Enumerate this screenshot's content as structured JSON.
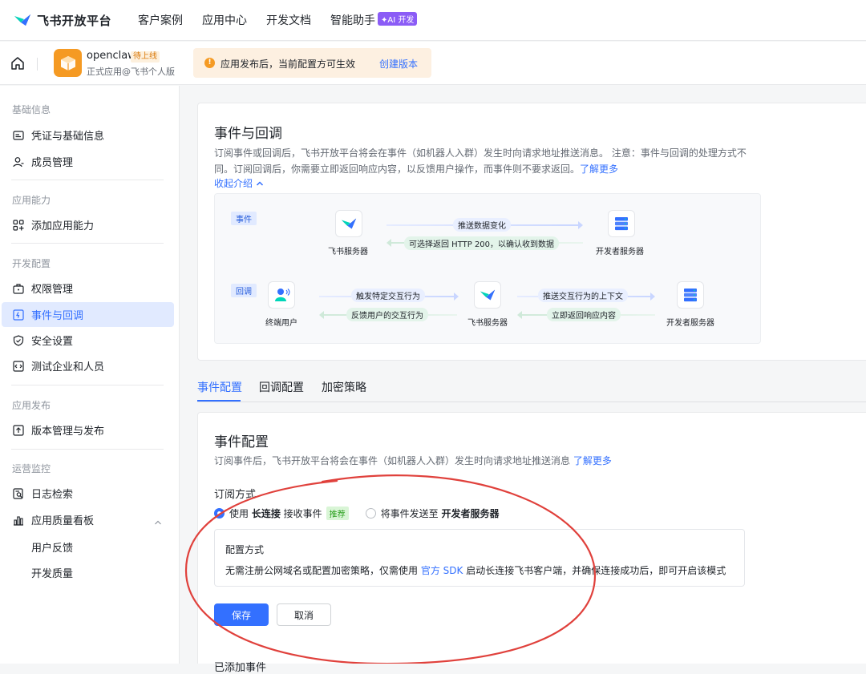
{
  "brand": {
    "name": "飞书开放平台"
  },
  "nav": {
    "items": [
      "客户案例",
      "应用中心",
      "开发文档",
      "智能助手"
    ],
    "ai_badge": "✦AI 开发"
  },
  "app": {
    "name": "openclaw",
    "status": "待上线",
    "owner": "正式应用@飞书个人版"
  },
  "notice": {
    "text": "应用发布后，当前配置方可生效",
    "link": "创建版本",
    "icon": "!"
  },
  "sidebar": {
    "groups": [
      "基础信息",
      "应用能力",
      "开发配置",
      "应用发布",
      "运营监控"
    ],
    "items": {
      "credentials": "凭证与基础信息",
      "members": "成员管理",
      "add_capability": "添加应用能力",
      "permissions": "权限管理",
      "events": "事件与回调",
      "security": "安全设置",
      "test_org": "测试企业和人员",
      "versions": "版本管理与发布",
      "logs": "日志检索",
      "quality_board": "应用质量看板",
      "feedback": "用户反馈",
      "dev_quality": "开发质量"
    }
  },
  "intro": {
    "title": "事件与回调",
    "desc": "订阅事件或回调后，飞书开放平台将会在事件（如机器人入群）发生时向请求地址推送消息。 注意：事件与回调的处理方式不同。订阅回调后，你需要立即返回响应内容，以反馈用户操作，而事件则不要求返回。",
    "learn_more": "了解更多",
    "collapse": "收起介绍"
  },
  "diagram": {
    "event_tag": "事件",
    "callback_tag": "回调",
    "feishu_server": "飞书服务器",
    "dev_server": "开发者服务器",
    "end_user": "终端用户",
    "push_data": "推送数据变化",
    "return_http": "可选择返回 HTTP 200，以确认收到数据",
    "trigger": "触发特定交互行为",
    "feedback": "反馈用户的交互行为",
    "push_context": "推送交互行为的上下文",
    "return_now": "立即返回响应内容"
  },
  "tabs": [
    "事件配置",
    "回调配置",
    "加密策略"
  ],
  "event_config": {
    "title": "事件配置",
    "desc": "订阅事件后，飞书开放平台将会在事件（如机器人入群）发生时向请求地址推送消息",
    "learn_more": "了解更多",
    "subscribe_label": "订阅方式",
    "opt1_pre": "使用 ",
    "opt1_bold": "长连接",
    "opt1_post": " 接收事件",
    "recommend": "推荐",
    "opt2_pre": "将事件发送至 ",
    "opt2_bold": "开发者服务器",
    "config_title": "配置方式",
    "config_desc_pre": "无需注册公网域名或配置加密策略，仅需使用 ",
    "config_link": "官方 SDK",
    "config_desc_post": " 启动长连接飞书客户端，并确保连接成功后，即可开启该模式",
    "save": "保存",
    "cancel": "取消",
    "added_events": "已添加事件"
  },
  "colors": {
    "accent": "#3370ff",
    "warning": "#f59a23",
    "annotation": "#e0413c"
  }
}
